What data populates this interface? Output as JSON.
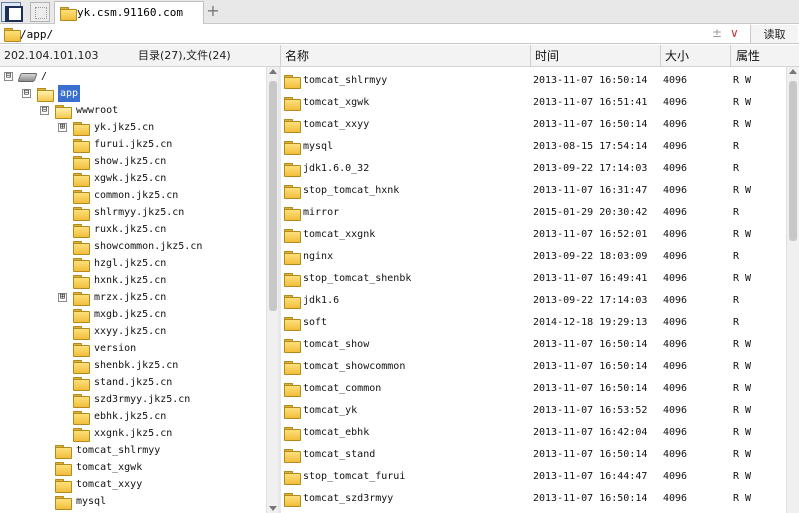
{
  "tab": {
    "title": "yk.csm.91160.com",
    "add_label": "+"
  },
  "pathbar": {
    "path": "/app/",
    "plusminus": "±",
    "dropdown": "∨",
    "read_label": "读取"
  },
  "header": {
    "ip": "202.104.101.103",
    "counts": "目录(27),文件(24)",
    "col_name": "名称",
    "col_time": "时间",
    "col_size": "大小",
    "col_attr": "属性"
  },
  "icons": {
    "folder": "folder-icon",
    "drive": "drive-icon",
    "expander": "expand-icon"
  },
  "colors": {
    "selection": "#3a6fd0",
    "folder": "#f1be3c"
  },
  "tree": [
    {
      "label": "/",
      "depth": 0,
      "expander": "⊟",
      "icon": "drive"
    },
    {
      "label": "app",
      "depth": 1,
      "expander": "⊟",
      "icon": "folder-open",
      "selected": true
    },
    {
      "label": "wwwroot",
      "depth": 2,
      "expander": "⊟",
      "icon": "folder-open"
    },
    {
      "label": "yk.jkz5.cn",
      "depth": 3,
      "expander": "⊞",
      "icon": "folder"
    },
    {
      "label": "furui.jkz5.cn",
      "depth": 3,
      "icon": "folder"
    },
    {
      "label": "show.jkz5.cn",
      "depth": 3,
      "icon": "folder"
    },
    {
      "label": "xgwk.jkz5.cn",
      "depth": 3,
      "icon": "folder"
    },
    {
      "label": "common.jkz5.cn",
      "depth": 3,
      "icon": "folder"
    },
    {
      "label": "shlrmyy.jkz5.cn",
      "depth": 3,
      "icon": "folder"
    },
    {
      "label": "ruxk.jkz5.cn",
      "depth": 3,
      "icon": "folder"
    },
    {
      "label": "showcommon.jkz5.cn",
      "depth": 3,
      "icon": "folder"
    },
    {
      "label": "hzgl.jkz5.cn",
      "depth": 3,
      "icon": "folder"
    },
    {
      "label": "hxnk.jkz5.cn",
      "depth": 3,
      "icon": "folder"
    },
    {
      "label": "mrzx.jkz5.cn",
      "depth": 3,
      "expander": "⊞",
      "icon": "folder"
    },
    {
      "label": "mxgb.jkz5.cn",
      "depth": 3,
      "icon": "folder"
    },
    {
      "label": "xxyy.jkz5.cn",
      "depth": 3,
      "icon": "folder"
    },
    {
      "label": "version",
      "depth": 3,
      "icon": "folder"
    },
    {
      "label": "shenbk.jkz5.cn",
      "depth": 3,
      "icon": "folder"
    },
    {
      "label": "stand.jkz5.cn",
      "depth": 3,
      "icon": "folder"
    },
    {
      "label": "szd3rmyy.jkz5.cn",
      "depth": 3,
      "icon": "folder"
    },
    {
      "label": "ebhk.jkz5.cn",
      "depth": 3,
      "icon": "folder"
    },
    {
      "label": "xxgnk.jkz5.cn",
      "depth": 3,
      "icon": "folder"
    },
    {
      "label": "tomcat_shlrmyy",
      "depth": 2,
      "icon": "folder"
    },
    {
      "label": "tomcat_xgwk",
      "depth": 2,
      "icon": "folder"
    },
    {
      "label": "tomcat_xxyy",
      "depth": 2,
      "icon": "folder"
    },
    {
      "label": "mysql",
      "depth": 2,
      "icon": "folder"
    }
  ],
  "files": [
    {
      "name": "tomcat_shlrmyy",
      "time": "2013-11-07 16:50:14",
      "size": "4096",
      "attr": "R W"
    },
    {
      "name": "tomcat_xgwk",
      "time": "2013-11-07 16:51:41",
      "size": "4096",
      "attr": "R W"
    },
    {
      "name": "tomcat_xxyy",
      "time": "2013-11-07 16:50:14",
      "size": "4096",
      "attr": "R W"
    },
    {
      "name": "mysql",
      "time": "2013-08-15 17:54:14",
      "size": "4096",
      "attr": "R"
    },
    {
      "name": "jdk1.6.0_32",
      "time": "2013-09-22 17:14:03",
      "size": "4096",
      "attr": "R"
    },
    {
      "name": "stop_tomcat_hxnk",
      "time": "2013-11-07 16:31:47",
      "size": "4096",
      "attr": "R W"
    },
    {
      "name": "mirror",
      "time": "2015-01-29 20:30:42",
      "size": "4096",
      "attr": "R"
    },
    {
      "name": "tomcat_xxgnk",
      "time": "2013-11-07 16:52:01",
      "size": "4096",
      "attr": "R W"
    },
    {
      "name": "nginx",
      "time": "2013-09-22 18:03:09",
      "size": "4096",
      "attr": "R"
    },
    {
      "name": "stop_tomcat_shenbk",
      "time": "2013-11-07 16:49:41",
      "size": "4096",
      "attr": "R W"
    },
    {
      "name": "jdk1.6",
      "time": "2013-09-22 17:14:03",
      "size": "4096",
      "attr": "R"
    },
    {
      "name": "soft",
      "time": "2014-12-18 19:29:13",
      "size": "4096",
      "attr": "R"
    },
    {
      "name": "tomcat_show",
      "time": "2013-11-07 16:50:14",
      "size": "4096",
      "attr": "R W"
    },
    {
      "name": "tomcat_showcommon",
      "time": "2013-11-07 16:50:14",
      "size": "4096",
      "attr": "R W"
    },
    {
      "name": "tomcat_common",
      "time": "2013-11-07 16:50:14",
      "size": "4096",
      "attr": "R W"
    },
    {
      "name": "tomcat_yk",
      "time": "2013-11-07 16:53:52",
      "size": "4096",
      "attr": "R W"
    },
    {
      "name": "tomcat_ebhk",
      "time": "2013-11-07 16:42:04",
      "size": "4096",
      "attr": "R W"
    },
    {
      "name": "tomcat_stand",
      "time": "2013-11-07 16:50:14",
      "size": "4096",
      "attr": "R W"
    },
    {
      "name": "stop_tomcat_furui",
      "time": "2013-11-07 16:44:47",
      "size": "4096",
      "attr": "R W"
    },
    {
      "name": "tomcat_szd3rmyy",
      "time": "2013-11-07 16:50:14",
      "size": "4096",
      "attr": "R W"
    }
  ]
}
